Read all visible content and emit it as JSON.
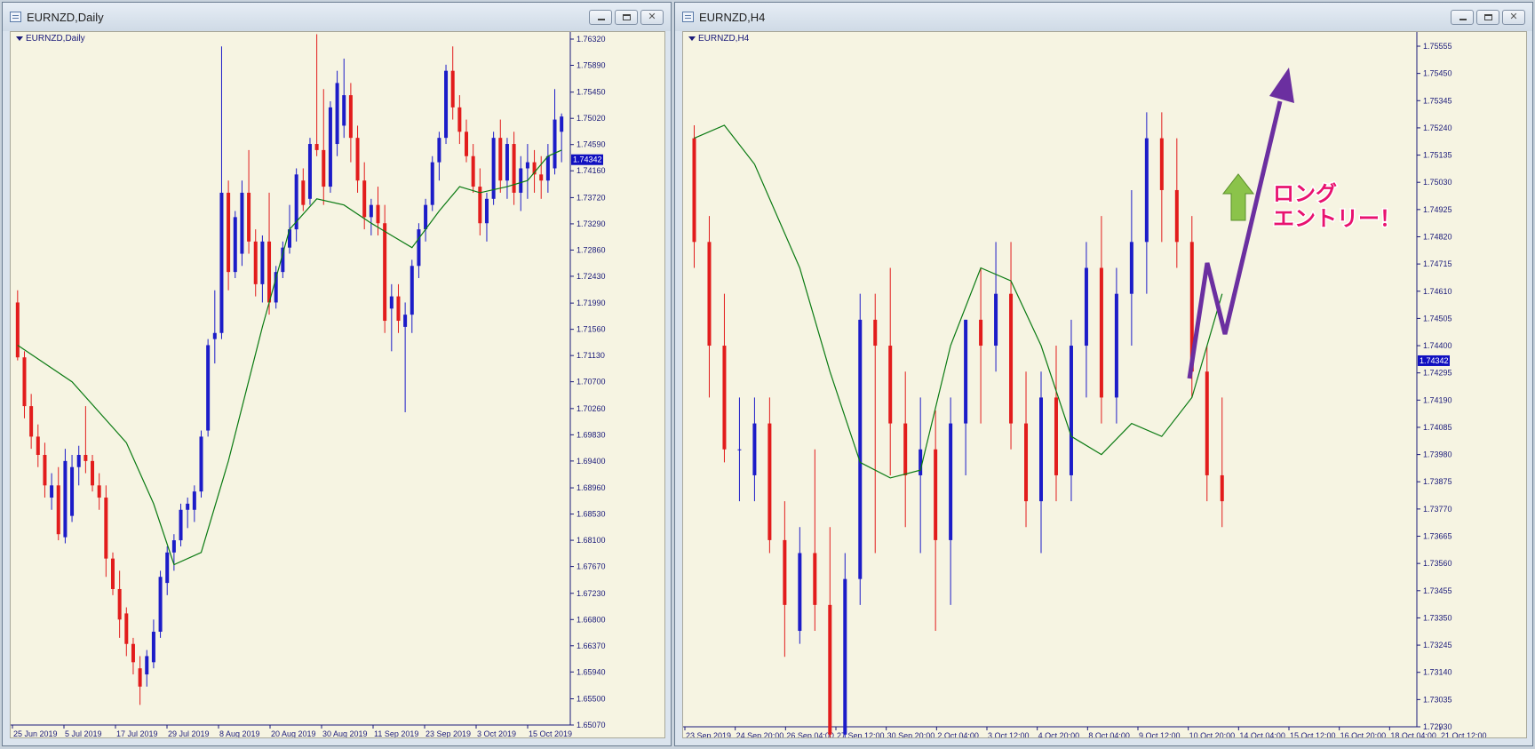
{
  "windows": [
    {
      "id": "left",
      "title": "EURNZD,Daily",
      "chart_label": "EURNZD,Daily",
      "close_glyph": "✕"
    },
    {
      "id": "right",
      "title": "EURNZD,H4",
      "chart_label": "EURNZD,H4",
      "close_glyph": "✕"
    }
  ],
  "annotation": {
    "line1": "ロング",
    "line2": "エントリー！"
  },
  "colors": {
    "bull": "#1c1cc8",
    "bear": "#e21c1c",
    "ma": "#0a7a12",
    "background": "#f6f4e2",
    "axis": "#1a1a7a",
    "arrow_purple": "#6b2fa0",
    "arrow_green": "#8bc34a",
    "annotation_text": "#e8126f"
  },
  "chart_data": [
    {
      "type": "candlestick",
      "symbol": "EURNZD",
      "timeframe": "Daily",
      "current_price": "1.74342",
      "ylim": [
        1.6507,
        1.7632
      ],
      "y_ticks": [
        "1.76320",
        "1.75890",
        "1.75450",
        "1.75020",
        "1.74590",
        "1.74160",
        "1.73720",
        "1.73290",
        "1.72860",
        "1.72430",
        "1.71990",
        "1.71560",
        "1.71130",
        "1.70700",
        "1.70260",
        "1.69830",
        "1.69400",
        "1.68960",
        "1.68530",
        "1.68100",
        "1.67670",
        "1.67230",
        "1.66800",
        "1.66370",
        "1.65940",
        "1.65500",
        "1.65070"
      ],
      "x_labels": [
        "25 Jun 2019",
        "5 Jul 2019",
        "17 Jul 2019",
        "29 Jul 2019",
        "8 Aug 2019",
        "20 Aug 2019",
        "30 Aug 2019",
        "11 Sep 2019",
        "23 Sep 2019",
        "3 Oct 2019",
        "15 Oct 2019"
      ],
      "candles": [
        [
          1.72,
          1.722,
          1.7105,
          1.711
        ],
        [
          1.711,
          1.712,
          1.701,
          1.703
        ],
        [
          1.703,
          1.705,
          1.696,
          1.698
        ],
        [
          1.698,
          1.7,
          1.693,
          1.695
        ],
        [
          1.695,
          1.697,
          1.688,
          1.69
        ],
        [
          1.688,
          1.692,
          1.686,
          1.69
        ],
        [
          1.69,
          1.693,
          1.681,
          1.682
        ],
        [
          1.6815,
          1.696,
          1.6805,
          1.694
        ],
        [
          1.685,
          1.695,
          1.684,
          1.693
        ],
        [
          1.693,
          1.6965,
          1.69,
          1.695
        ],
        [
          1.695,
          1.703,
          1.692,
          1.694
        ],
        [
          1.694,
          1.695,
          1.689,
          1.69
        ],
        [
          1.69,
          1.692,
          1.686,
          1.688
        ],
        [
          1.688,
          1.69,
          1.675,
          1.678
        ],
        [
          1.678,
          1.679,
          1.672,
          1.673
        ],
        [
          1.673,
          1.676,
          1.665,
          1.668
        ],
        [
          1.669,
          1.67,
          1.662,
          1.664
        ],
        [
          1.664,
          1.665,
          1.659,
          1.661
        ],
        [
          1.66,
          1.662,
          1.654,
          1.657
        ],
        [
          1.659,
          1.663,
          1.657,
          1.662
        ],
        [
          1.661,
          1.668,
          1.66,
          1.666
        ],
        [
          1.666,
          1.676,
          1.665,
          1.675
        ],
        [
          1.674,
          1.68,
          1.672,
          1.679
        ],
        [
          1.679,
          1.682,
          1.676,
          1.681
        ],
        [
          1.681,
          1.687,
          1.68,
          1.686
        ],
        [
          1.686,
          1.688,
          1.683,
          1.687
        ],
        [
          1.686,
          1.69,
          1.684,
          1.689
        ],
        [
          1.689,
          1.699,
          1.688,
          1.698
        ],
        [
          1.699,
          1.714,
          1.698,
          1.713
        ],
        [
          1.714,
          1.722,
          1.71,
          1.715
        ],
        [
          1.715,
          1.762,
          1.714,
          1.738
        ],
        [
          1.738,
          1.74,
          1.722,
          1.725
        ],
        [
          1.725,
          1.735,
          1.724,
          1.734
        ],
        [
          1.728,
          1.74,
          1.726,
          1.738
        ],
        [
          1.738,
          1.745,
          1.728,
          1.73
        ],
        [
          1.73,
          1.732,
          1.721,
          1.723
        ],
        [
          1.723,
          1.731,
          1.72,
          1.73
        ],
        [
          1.73,
          1.738,
          1.718,
          1.72
        ],
        [
          1.72,
          1.726,
          1.719,
          1.725
        ],
        [
          1.725,
          1.73,
          1.724,
          1.729
        ],
        [
          1.729,
          1.736,
          1.728,
          1.732
        ],
        [
          1.732,
          1.742,
          1.73,
          1.741
        ],
        [
          1.74,
          1.742,
          1.735,
          1.736
        ],
        [
          1.737,
          1.747,
          1.736,
          1.746
        ],
        [
          1.746,
          1.764,
          1.744,
          1.745
        ],
        [
          1.745,
          1.755,
          1.736,
          1.739
        ],
        [
          1.739,
          1.753,
          1.738,
          1.752
        ],
        [
          1.746,
          1.758,
          1.744,
          1.756
        ],
        [
          1.749,
          1.76,
          1.747,
          1.754
        ],
        [
          1.754,
          1.756,
          1.743,
          1.747
        ],
        [
          1.747,
          1.749,
          1.738,
          1.74
        ],
        [
          1.74,
          1.743,
          1.732,
          1.734
        ],
        [
          1.734,
          1.737,
          1.731,
          1.736
        ],
        [
          1.736,
          1.739,
          1.731,
          1.733
        ],
        [
          1.733,
          1.736,
          1.715,
          1.717
        ],
        [
          1.719,
          1.723,
          1.712,
          1.721
        ],
        [
          1.721,
          1.723,
          1.715,
          1.717
        ],
        [
          1.716,
          1.72,
          1.702,
          1.718
        ],
        [
          1.718,
          1.727,
          1.715,
          1.726
        ],
        [
          1.726,
          1.733,
          1.724,
          1.732
        ],
        [
          1.732,
          1.737,
          1.73,
          1.736
        ],
        [
          1.736,
          1.744,
          1.735,
          1.743
        ],
        [
          1.743,
          1.748,
          1.74,
          1.747
        ],
        [
          1.747,
          1.759,
          1.746,
          1.758
        ],
        [
          1.758,
          1.762,
          1.75,
          1.752
        ],
        [
          1.752,
          1.754,
          1.746,
          1.748
        ],
        [
          1.748,
          1.75,
          1.743,
          1.744
        ],
        [
          1.744,
          1.746,
          1.738,
          1.739
        ],
        [
          1.739,
          1.742,
          1.731,
          1.733
        ],
        [
          1.733,
          1.738,
          1.73,
          1.737
        ],
        [
          1.737,
          1.748,
          1.736,
          1.747
        ],
        [
          1.747,
          1.75,
          1.738,
          1.74
        ],
        [
          1.74,
          1.747,
          1.737,
          1.746
        ],
        [
          1.746,
          1.748,
          1.736,
          1.738
        ],
        [
          1.738,
          1.744,
          1.735,
          1.742
        ],
        [
          1.742,
          1.746,
          1.737,
          1.743
        ],
        [
          1.743,
          1.745,
          1.738,
          1.741
        ],
        [
          1.741,
          1.744,
          1.737,
          1.74
        ],
        [
          1.74,
          1.746,
          1.738,
          1.744
        ],
        [
          1.742,
          1.755,
          1.741,
          1.75
        ],
        [
          1.748,
          1.751,
          1.743,
          1.7505
        ]
      ],
      "ma": [
        [
          0,
          1.713
        ],
        [
          8,
          1.707
        ],
        [
          16,
          1.697
        ],
        [
          20,
          1.687
        ],
        [
          23,
          1.677
        ],
        [
          27,
          1.679
        ],
        [
          31,
          1.694
        ],
        [
          36,
          1.716
        ],
        [
          40,
          1.732
        ],
        [
          44,
          1.737
        ],
        [
          48,
          1.736
        ],
        [
          52,
          1.733
        ],
        [
          55,
          1.731
        ],
        [
          58,
          1.729
        ],
        [
          62,
          1.735
        ],
        [
          65,
          1.739
        ],
        [
          68,
          1.738
        ],
        [
          72,
          1.739
        ],
        [
          75,
          1.74
        ],
        [
          78,
          1.744
        ],
        [
          80,
          1.745
        ]
      ]
    },
    {
      "type": "candlestick",
      "symbol": "EURNZD",
      "timeframe": "H4",
      "current_price": "1.74342",
      "ylim": [
        1.7293,
        1.75555
      ],
      "y_ticks": [
        "1.75555",
        "1.75450",
        "1.75345",
        "1.75240",
        "1.75135",
        "1.75030",
        "1.74925",
        "1.74820",
        "1.74715",
        "1.74610",
        "1.74505",
        "1.74400",
        "1.74295",
        "1.74190",
        "1.74085",
        "1.73980",
        "1.73875",
        "1.73770",
        "1.73665",
        "1.73560",
        "1.73455",
        "1.73350",
        "1.73245",
        "1.73140",
        "1.73035",
        "1.72930"
      ],
      "x_labels": [
        "23 Sep 2019",
        "24 Sep 20:00",
        "26 Sep 04:00",
        "27 Sep 12:00",
        "30 Sep 20:00",
        "2 Oct 04:00",
        "3 Oct 12:00",
        "4 Oct 20:00",
        "8 Oct 04:00",
        "9 Oct 12:00",
        "10 Oct 20:00",
        "14 Oct 04:00",
        "15 Oct 12:00",
        "16 Oct 20:00",
        "18 Oct 04:00",
        "21 Oct 12:00"
      ],
      "candles": [
        [
          1.752,
          1.7525,
          1.747,
          1.748
        ],
        [
          1.748,
          1.749,
          1.742,
          1.744
        ],
        [
          1.744,
          1.746,
          1.7395,
          1.74
        ],
        [
          1.74,
          1.742,
          1.738,
          1.74
        ],
        [
          1.739,
          1.742,
          1.738,
          1.741
        ],
        [
          1.741,
          1.742,
          1.736,
          1.7365
        ],
        [
          1.7365,
          1.738,
          1.732,
          1.734
        ],
        [
          1.733,
          1.737,
          1.7325,
          1.736
        ],
        [
          1.736,
          1.74,
          1.733,
          1.734
        ],
        [
          1.734,
          1.737,
          1.727,
          1.729
        ],
        [
          1.729,
          1.736,
          1.728,
          1.735
        ],
        [
          1.735,
          1.746,
          1.734,
          1.745
        ],
        [
          1.745,
          1.746,
          1.736,
          1.744
        ],
        [
          1.744,
          1.747,
          1.739,
          1.741
        ],
        [
          1.741,
          1.743,
          1.737,
          1.739
        ],
        [
          1.739,
          1.742,
          1.736,
          1.74
        ],
        [
          1.74,
          1.7415,
          1.733,
          1.7365
        ],
        [
          1.7365,
          1.742,
          1.734,
          1.741
        ],
        [
          1.741,
          1.745,
          1.739,
          1.745
        ],
        [
          1.745,
          1.747,
          1.741,
          1.744
        ],
        [
          1.744,
          1.748,
          1.743,
          1.746
        ],
        [
          1.746,
          1.748,
          1.74,
          1.741
        ],
        [
          1.741,
          1.743,
          1.737,
          1.738
        ],
        [
          1.738,
          1.743,
          1.736,
          1.742
        ],
        [
          1.742,
          1.744,
          1.738,
          1.739
        ],
        [
          1.739,
          1.745,
          1.738,
          1.744
        ],
        [
          1.744,
          1.748,
          1.742,
          1.747
        ],
        [
          1.747,
          1.749,
          1.741,
          1.742
        ],
        [
          1.742,
          1.747,
          1.741,
          1.746
        ],
        [
          1.746,
          1.75,
          1.744,
          1.748
        ],
        [
          1.748,
          1.753,
          1.746,
          1.752
        ],
        [
          1.752,
          1.753,
          1.748,
          1.75
        ],
        [
          1.75,
          1.752,
          1.747,
          1.748
        ],
        [
          1.748,
          1.749,
          1.742,
          1.743
        ],
        [
          1.743,
          1.744,
          1.738,
          1.739
        ],
        [
          1.739,
          1.742,
          1.737,
          1.738
        ]
      ],
      "ma": [
        [
          0,
          1.752
        ],
        [
          2,
          1.7525
        ],
        [
          4,
          1.751
        ],
        [
          7,
          1.747
        ],
        [
          9,
          1.743
        ],
        [
          11,
          1.7395
        ],
        [
          13,
          1.7389
        ],
        [
          15,
          1.7392
        ],
        [
          17,
          1.744
        ],
        [
          19,
          1.747
        ],
        [
          21,
          1.7465
        ],
        [
          23,
          1.744
        ],
        [
          25,
          1.7405
        ],
        [
          27,
          1.7398
        ],
        [
          29,
          1.741
        ],
        [
          31,
          1.7405
        ],
        [
          33,
          1.742
        ],
        [
          35,
          1.746
        ]
      ]
    }
  ]
}
